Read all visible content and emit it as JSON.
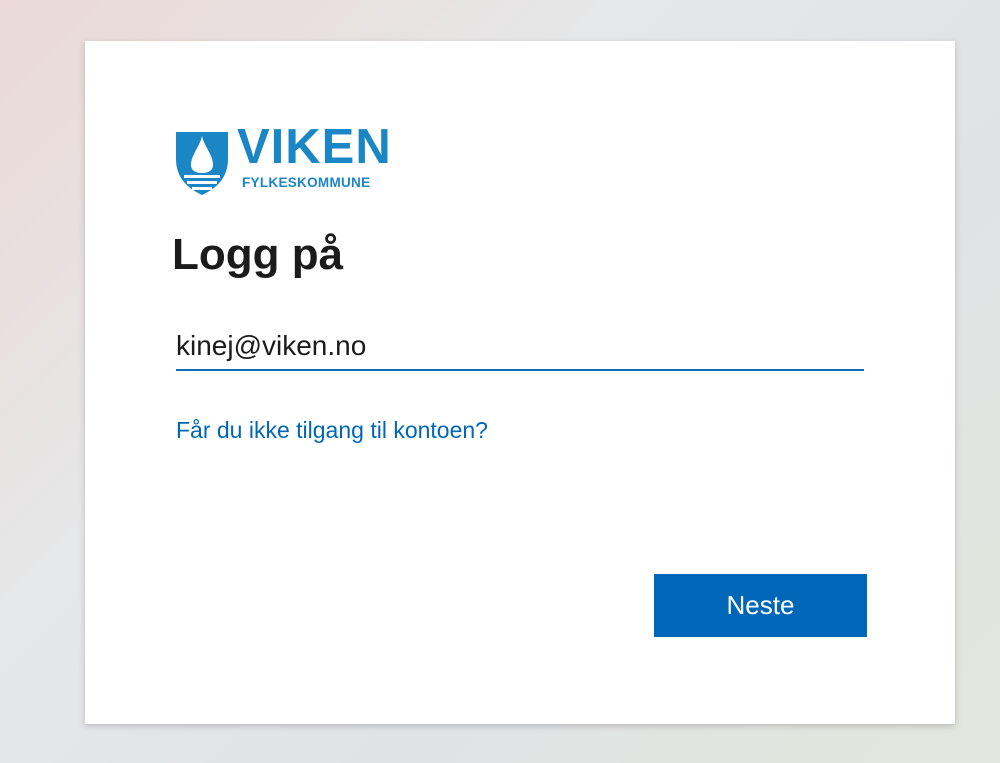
{
  "brand": {
    "name": "VIKEN",
    "subtitle": "FYLKESKOMMUNE",
    "color": "#1b86c6"
  },
  "page_title": "Logg på",
  "email_field": {
    "value": "kinej@viken.no",
    "accent": "#0f6cbd"
  },
  "help_link": "Får du ikke tilgang til kontoen?",
  "next_button": {
    "label": "Neste",
    "color": "#0067b8"
  },
  "icons": {
    "logo": "shield-icon"
  }
}
